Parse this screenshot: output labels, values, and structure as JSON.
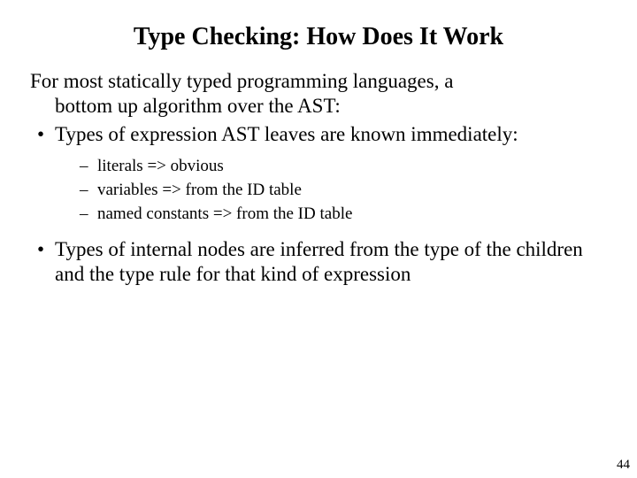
{
  "title": "Type Checking: How Does It Work",
  "intro_line1": "For most statically typed programming languages, a",
  "intro_line2": "bottom up algorithm over the AST:",
  "bullets": {
    "b1": "Types of expression AST  leaves are known immediately:",
    "sub1": "literals => obvious",
    "sub2": "variables => from the ID table",
    "sub3": "named constants => from the ID table",
    "b2": "Types of internal nodes are inferred from the type of the children and the type rule for that kind of expression"
  },
  "page_number": "44"
}
